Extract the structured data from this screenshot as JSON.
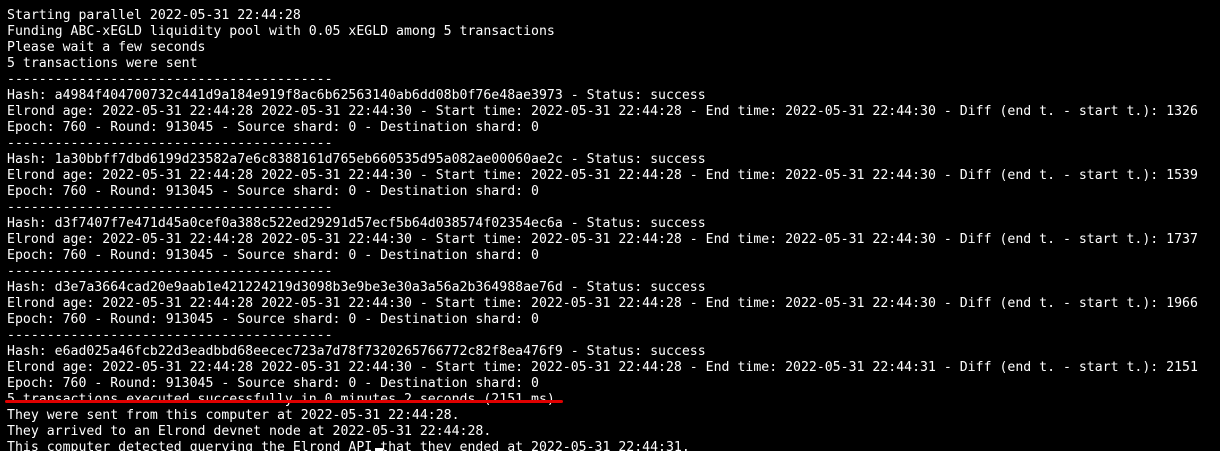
{
  "terminal": {
    "lines": [
      "",
      "Starting parallel 2022-05-31 22:44:28",
      "Funding ABC-xEGLD liquidity pool with 0.05 xEGLD among 5 transactions",
      "Please wait a few seconds",
      "5 transactions were sent",
      "-----------------------------------------",
      "Hash: a4984f404700732c441d9a184e919f8ac6b62563140ab6dd08b0f76e48ae3973 - Status: success",
      "Elrond age: 2022-05-31 22:44:28 2022-05-31 22:44:30 - Start time: 2022-05-31 22:44:28 - End time: 2022-05-31 22:44:30 - Diff (end t. - start t.): 1326",
      "Epoch: 760 - Round: 913045 - Source shard: 0 - Destination shard: 0",
      "-----------------------------------------",
      "Hash: 1a30bbff7dbd6199d23582a7e6c8388161d765eb660535d95a082ae00060ae2c - Status: success",
      "Elrond age: 2022-05-31 22:44:28 2022-05-31 22:44:30 - Start time: 2022-05-31 22:44:28 - End time: 2022-05-31 22:44:30 - Diff (end t. - start t.): 1539",
      "Epoch: 760 - Round: 913045 - Source shard: 0 - Destination shard: 0",
      "-----------------------------------------",
      "Hash: d3f7407f7e471d45a0cef0a388c522ed29291d57ecf5b64d038574f02354ec6a - Status: success",
      "Elrond age: 2022-05-31 22:44:28 2022-05-31 22:44:30 - Start time: 2022-05-31 22:44:28 - End time: 2022-05-31 22:44:30 - Diff (end t. - start t.): 1737",
      "Epoch: 760 - Round: 913045 - Source shard: 0 - Destination shard: 0",
      "-----------------------------------------",
      "Hash: d3e7a3664cad20e9aab1e421224219d3098b3e9be3e30a3a56a2b364988ae76d - Status: success",
      "Elrond age: 2022-05-31 22:44:28 2022-05-31 22:44:30 - Start time: 2022-05-31 22:44:28 - End time: 2022-05-31 22:44:30 - Diff (end t. - start t.): 1966",
      "Epoch: 760 - Round: 913045 - Source shard: 0 - Destination shard: 0",
      "-----------------------------------------",
      "Hash: e6ad025a46fcb22d3eadbbd68eecec723a7d78f7320265766772c82f8ea476f9 - Status: success",
      "Elrond age: 2022-05-31 22:44:28 2022-05-31 22:44:30 - Start time: 2022-05-31 22:44:28 - End time: 2022-05-31 22:44:31 - Diff (end t. - start t.): 2151",
      "Epoch: 760 - Round: 913045 - Source shard: 0 - Destination shard: 0",
      "5 transactions executed successfully in 0 minutes 2 seconds (2151 ms).",
      "They were sent from this computer at 2022-05-31 22:44:28.",
      "They arrived to an Elrond devnet node at 2022-05-31 22:44:28.",
      "This computer detected querying the Elrond API that they ended at 2022-05-31 22:44:31."
    ]
  },
  "colors": {
    "background": "#000000",
    "text": "#ffffff",
    "highlight_underline": "#e00000"
  }
}
